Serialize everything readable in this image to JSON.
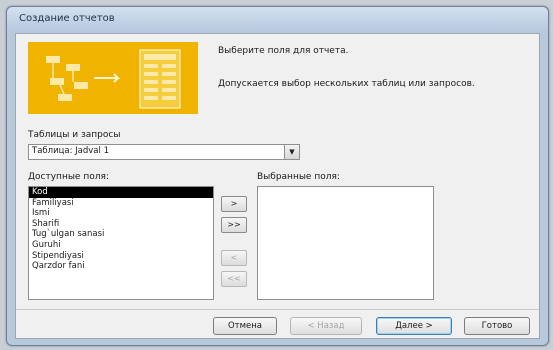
{
  "window": {
    "title": "Создание отчетов"
  },
  "banner": {
    "icon": "report-wizard-graphic-icon",
    "accent": "#f0b400"
  },
  "intro": {
    "line1": "Выберите поля для отчета.",
    "line2": "Допускается выбор нескольких таблиц или запросов."
  },
  "tables": {
    "label": "Таблицы и запросы",
    "selected": "Таблица: Jadval 1",
    "dropdown_icon": "▼"
  },
  "available": {
    "label": "Доступные поля:",
    "items": [
      "Kod",
      "Familiyasi",
      "Ismi",
      "Sharifi",
      "Tug`ulgan sanasi",
      "Guruhi",
      "Stipendiyasi",
      "Qarzdor fani"
    ]
  },
  "selected_fields": {
    "label": "Выбранные поля:",
    "items": []
  },
  "move": {
    "add_one": ">",
    "add_all": ">>",
    "remove_one": "<",
    "remove_all": "<<"
  },
  "buttons": {
    "cancel": "Отмена",
    "back": "< Назад",
    "next": "Далее >",
    "finish": "Готово"
  }
}
